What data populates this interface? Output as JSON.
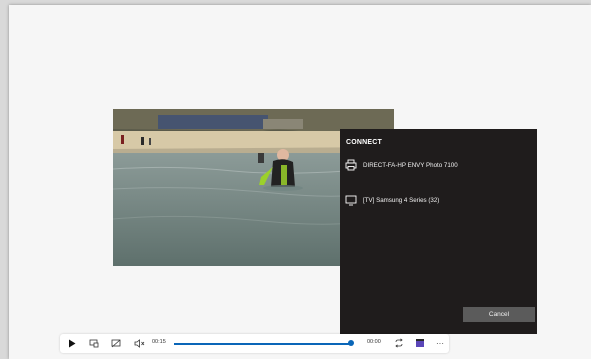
{
  "connect_panel": {
    "title": "CONNECT",
    "devices": [
      {
        "label": "DIRECT-FA-HP ENVY Photo 7100",
        "icon": "printer-icon"
      },
      {
        "label": "[TV] Samsung 4 Series (32)",
        "icon": "monitor-icon"
      }
    ],
    "cancel_label": "Cancel"
  },
  "player": {
    "current_time": "00:15",
    "remaining_time": "00:00",
    "progress": 1.0,
    "buttons": [
      "play-icon",
      "mini-view-icon",
      "cast-icon",
      "volume-icon",
      "repeat-icon",
      "playlist-icon",
      "more-icon"
    ],
    "more_label": "···"
  },
  "colors": {
    "accent": "#0a66b8",
    "panel_bg": "#1f1c1c",
    "cancel_bg": "#5b5b5b",
    "window_bg": "#f6f6f6"
  }
}
